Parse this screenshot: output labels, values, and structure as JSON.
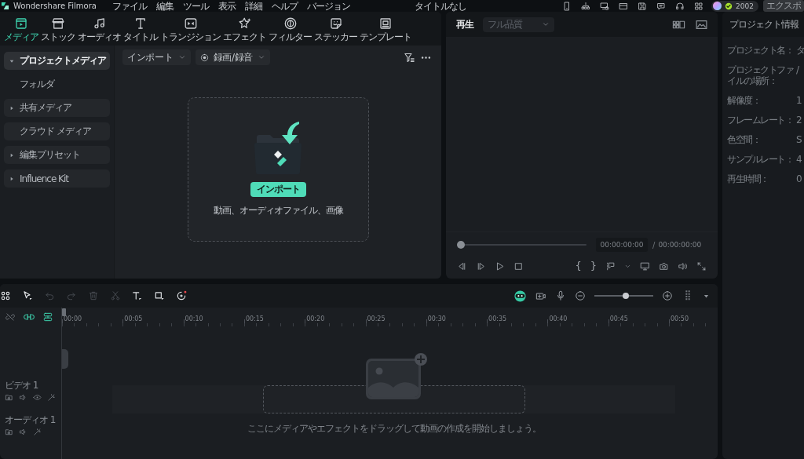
{
  "title_bar": {
    "app_name": "Wondershare Filmora",
    "menus": [
      "ファイル",
      "編集",
      "ツール",
      "表示",
      "詳細",
      "ヘルプ",
      "バージョン"
    ],
    "document_title": "タイトルなし",
    "credits": "2002",
    "export_label": "エクスポ"
  },
  "media_tabs": [
    {
      "label": "メディア",
      "selected": true
    },
    {
      "label": "ストック",
      "selected": false
    },
    {
      "label": "オーディオ",
      "selected": false
    },
    {
      "label": "タイトル",
      "selected": false
    },
    {
      "label": "トランジション",
      "selected": false
    },
    {
      "label": "エフェクト",
      "selected": false
    },
    {
      "label": "フィルター",
      "selected": false
    },
    {
      "label": "ステッカー",
      "selected": false
    },
    {
      "label": "テンプレート",
      "selected": false
    }
  ],
  "sidebar": {
    "items": [
      {
        "label": "プロジェクトメディア",
        "expanded": true,
        "selected": true,
        "children": [
          {
            "label": "フォルダ",
            "selected": false
          }
        ]
      },
      {
        "label": "共有メディア",
        "expanded": false,
        "selected": false
      },
      {
        "label": "クラウド メディア",
        "selected": false
      },
      {
        "label": "編集プリセット",
        "expanded": false,
        "selected": false
      },
      {
        "label": "Influence Kit",
        "expanded": false,
        "selected": false
      }
    ]
  },
  "media_toolbar": {
    "import_label": "インポート",
    "record_label": "録画/録音"
  },
  "drop_zone": {
    "button_label": "インポート",
    "hint": "動画、オーディオファイル、画像"
  },
  "preview": {
    "title": "再生",
    "quality": "フル品質",
    "progress": {
      "level": 0
    },
    "timecode": "00:00:00:00",
    "separator": "/",
    "duration": "00:00:00:00",
    "mark_in": "{",
    "mark_out": "}"
  },
  "project_info": {
    "title": "プロジェクト情報",
    "rows": [
      {
        "label": "プロジェクト名：",
        "value": "タ"
      },
      {
        "label": "プロジェクトファイルの場所：",
        "value": "/"
      },
      {
        "label": "解像度：",
        "value": "1"
      },
      {
        "label": "フレームレート：",
        "value": "2"
      },
      {
        "label": "色空間：",
        "value": "S"
      },
      {
        "label": "サンプルレート：",
        "value": "4"
      },
      {
        "label": "再生時間：",
        "value": "0"
      }
    ]
  },
  "timeline": {
    "edit_tools": [
      {
        "disabled": false
      },
      {
        "disabled": false
      },
      {
        "disabled": true
      },
      {
        "disabled": true
      },
      {
        "disabled": true
      },
      {
        "disabled": true
      },
      {
        "disabled": false
      },
      {
        "disabled": false
      },
      {
        "disabled": false
      }
    ],
    "header_toggles": [
      {
        "kind": "unlink",
        "on": false
      },
      {
        "kind": "link",
        "on": true
      },
      {
        "kind": "stack",
        "on": true
      }
    ],
    "zoom": {
      "level": 0.53
    },
    "ruler_labels": [
      "00:00",
      "00:05",
      "00:10",
      "00:15",
      "00:20",
      "00:25",
      "00:30",
      "00:35",
      "00:40",
      "00:45",
      "00:50"
    ],
    "tracks": [
      {
        "kind": "video",
        "label": "ビデオ 1"
      },
      {
        "kind": "audio",
        "label": "オーディオ 1"
      }
    ],
    "hint": "ここにメディアやエフェクトをドラッグして動画の作成を開始しましょう。"
  }
}
